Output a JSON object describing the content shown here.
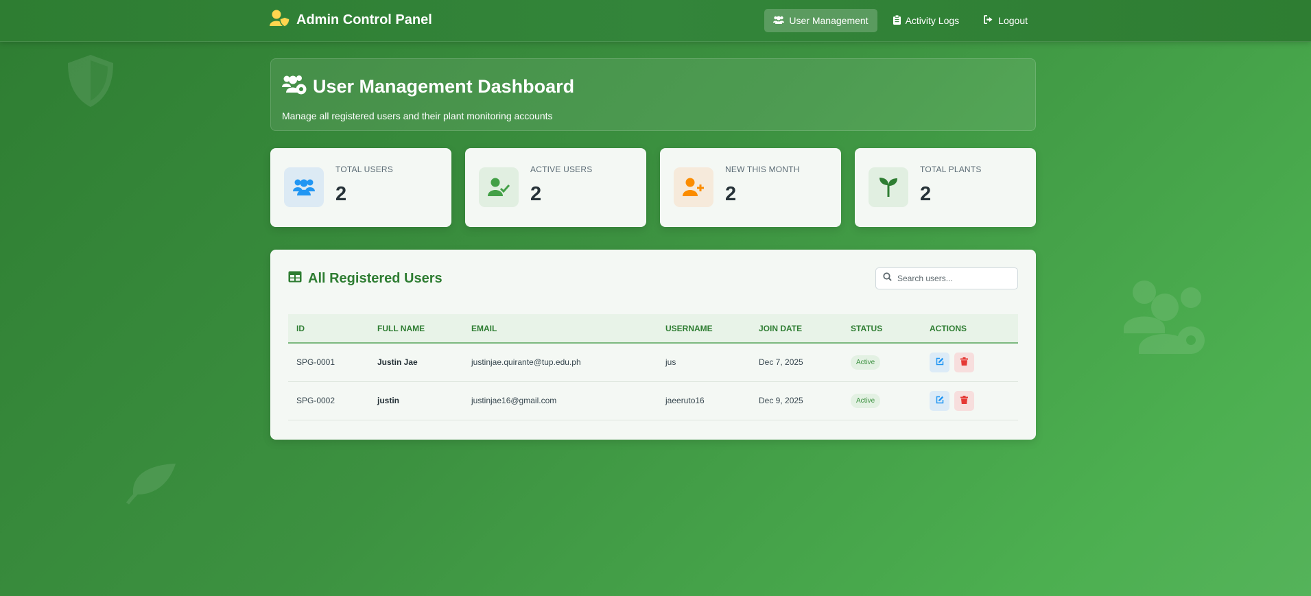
{
  "colors": {
    "brand_green": "#2e7d32",
    "accent_yellow": "#ffd54f",
    "blue": "#2196f3",
    "green": "#43a047",
    "orange": "#fb8c00",
    "red": "#e53935"
  },
  "navbar": {
    "brand_icon": "user-shield-icon",
    "brand_title": "Admin Control Panel",
    "links": [
      {
        "label": "User Management",
        "icon": "users-icon",
        "active": true
      },
      {
        "label": "Activity Logs",
        "icon": "clipboard-icon",
        "active": false
      },
      {
        "label": "Logout",
        "icon": "sign-out-icon",
        "active": false
      }
    ]
  },
  "header": {
    "icon": "users-cog-icon",
    "title": "User Management Dashboard",
    "subtitle": "Manage all registered users and their plant monitoring accounts"
  },
  "stats": [
    {
      "label": "TOTAL USERS",
      "value": "2",
      "icon": "users-icon"
    },
    {
      "label": "ACTIVE USERS",
      "value": "2",
      "icon": "user-check-icon"
    },
    {
      "label": "NEW THIS MONTH",
      "value": "2",
      "icon": "user-plus-icon"
    },
    {
      "label": "TOTAL PLANTS",
      "value": "2",
      "icon": "seedling-icon"
    }
  ],
  "users_panel": {
    "icon": "table-icon",
    "title": "All Registered Users",
    "search_placeholder": "Search users...",
    "columns": [
      "ID",
      "FULL NAME",
      "EMAIL",
      "USERNAME",
      "JOIN DATE",
      "STATUS",
      "ACTIONS"
    ],
    "rows": [
      {
        "id": "SPG-0001",
        "full_name": "Justin Jae",
        "email": "justinjae.quirante@tup.edu.ph",
        "username": "jus",
        "join_date": "Dec 7, 2025",
        "status": "Active"
      },
      {
        "id": "SPG-0002",
        "full_name": "justin",
        "email": "justinjae16@gmail.com",
        "username": "jaeeruto16",
        "join_date": "Dec 9, 2025",
        "status": "Active"
      }
    ]
  }
}
